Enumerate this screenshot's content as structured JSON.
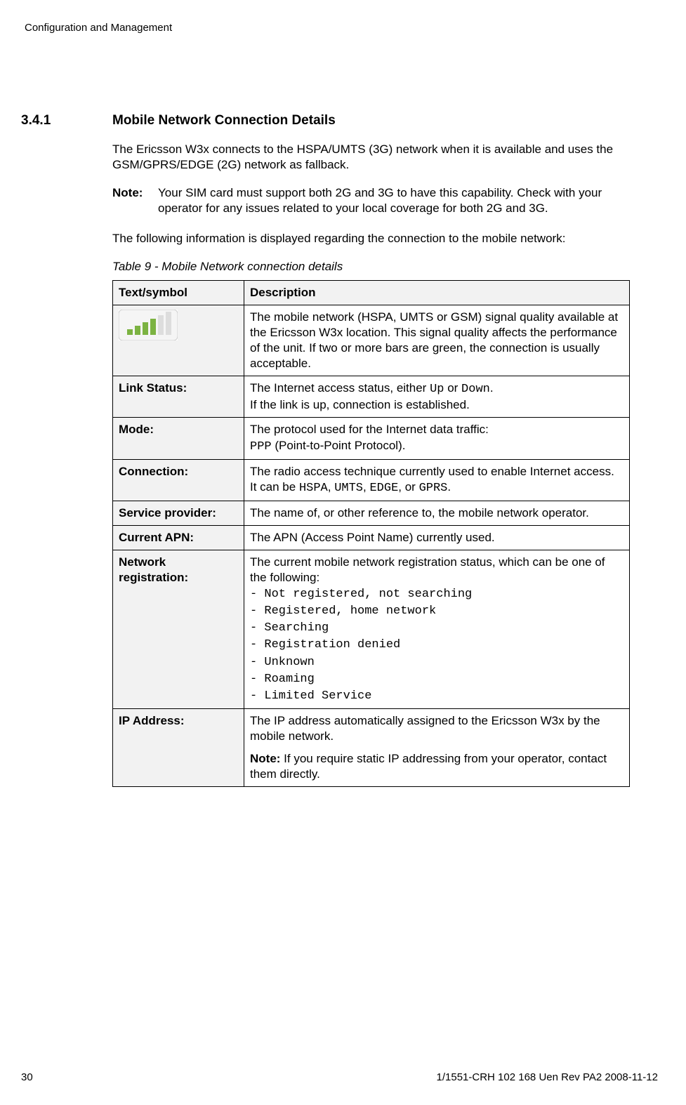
{
  "header": {
    "running": "Configuration and Management"
  },
  "section": {
    "number": "3.4.1",
    "title": "Mobile Network Connection Details"
  },
  "paragraphs": {
    "intro": "The Ericsson W3x connects to the HSPA/UMTS (3G) network when it is available and uses the GSM/GPRS/EDGE (2G) network as fallback.",
    "note_label": "Note:",
    "note_body": "Your SIM card must support both 2G and 3G to have this capability. Check with your operator for any issues related to your local coverage for both 2G and 3G.",
    "following": "The following information is displayed regarding the connection to the mobile network:"
  },
  "table": {
    "caption": "Table 9 - Mobile Network connection details",
    "head": {
      "c1": "Text/symbol",
      "c2": "Description"
    },
    "rows": {
      "signal": {
        "desc": "The mobile network (HSPA, UMTS or GSM) signal quality available at the Ericsson W3x location. This signal quality affects the performance of the unit.  If two or more bars are green, the connection is usually acceptable."
      },
      "link": {
        "label": "Link Status:",
        "desc_pre": "The Internet access status, either ",
        "code1": "Up",
        "mid1": " or ",
        "code2": "Down",
        "post": ".",
        "line2": "If the link is up, connection is established."
      },
      "mode": {
        "label": "Mode:",
        "line1": "The protocol used for the Internet data traffic:",
        "code": "PPP",
        "post": " (Point-to-Point Protocol)."
      },
      "conn": {
        "label": "Connection:",
        "pre": "The radio access technique currently used to enable Internet access. It can be ",
        "c1": "HSPA",
        "s1": ", ",
        "c2": "UMTS",
        "s2": ", ",
        "c3": "EDGE",
        "s3": ",  or ",
        "c4": "GPRS",
        "post": "."
      },
      "sp": {
        "label": "Service provider:",
        "desc": "The name of, or other reference to, the mobile network operator."
      },
      "apn": {
        "label": "Current APN:",
        "desc": "The APN (Access Point Name) currently used."
      },
      "netreg": {
        "label": "Network registration:",
        "intro": "The current mobile network registration status, which can be one of the following:",
        "l1": "- Not registered, not searching",
        "l2": "- Registered, home network",
        "l3": "- Searching",
        "l4": "- Registration denied",
        "l5": "- Unknown",
        "l6": "- Roaming",
        "l7": "- Limited Service"
      },
      "ip": {
        "label": "IP Address:",
        "p1": "The IP address automatically assigned to the Ericsson W3x by the mobile network.",
        "note_label": "Note:",
        "note_body": " If you require static IP addressing from your operator, contact them directly."
      }
    }
  },
  "footer": {
    "page": "30",
    "docref": "1/1551-CRH 102 168 Uen Rev PA2  2008-11-12"
  }
}
